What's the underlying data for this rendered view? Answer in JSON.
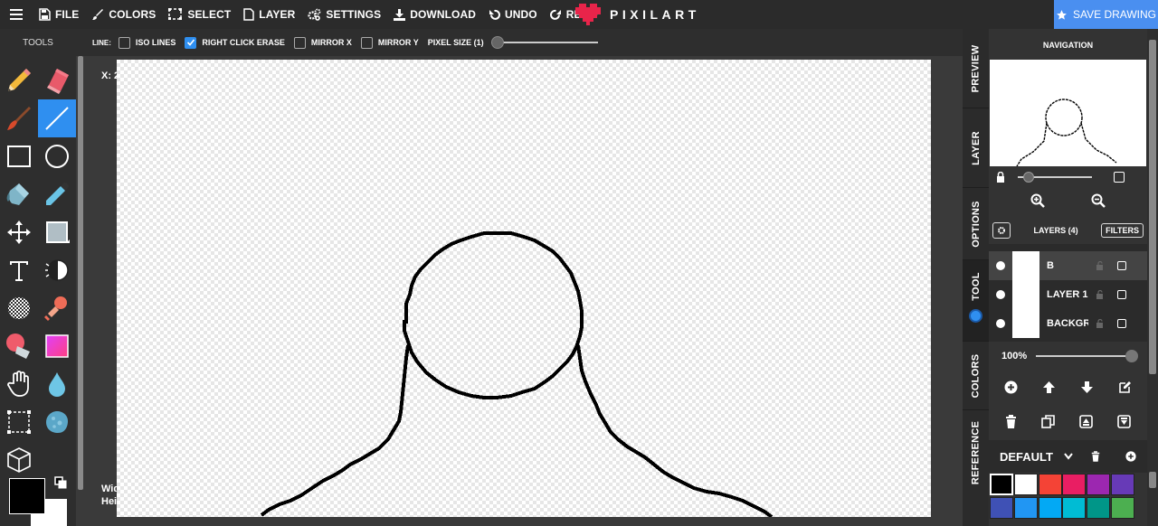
{
  "menu": {
    "items": [
      "FILE",
      "COLORS",
      "SELECT",
      "LAYER",
      "SETTINGS",
      "DOWNLOAD",
      "UNDO",
      "REDO"
    ],
    "logo": "PIXILART",
    "save": "SAVE DRAWING"
  },
  "tools": {
    "title": "TOOLS"
  },
  "options": {
    "line_label": "LINE:",
    "iso_lines": "ISO LINES",
    "right_click_erase": "RIGHT CLICK ERASE",
    "mirror_x": "MIRROR X",
    "mirror_y": "MIRROR Y",
    "pixel_size": "PIXEL SIZE (1)",
    "iso_checked": false,
    "erase_checked": true,
    "mirror_x_checked": false,
    "mirror_y_checked": false
  },
  "workspace": {
    "coord": "X: 2",
    "width_label": "Wid",
    "height_label": "Hei"
  },
  "sidetabs": [
    "PREVIEW",
    "LAYER",
    "OPTIONS",
    "TOOL",
    "COLORS",
    "REFERENCE"
  ],
  "navigation": {
    "title": "NAVIGATION"
  },
  "layers": {
    "title": "LAYERS (4)",
    "filters": "FILTERS",
    "items": [
      {
        "name": "B",
        "active": true
      },
      {
        "name": "LAYER 1",
        "active": false
      },
      {
        "name": "BACKGROUND",
        "active": false
      }
    ],
    "opacity": "100%"
  },
  "palette": {
    "name": "DEFAULT",
    "colors": [
      "#000000",
      "#ffffff",
      "#f44336",
      "#e91e63",
      "#9c27b0",
      "#673ab7",
      "#3f51b5",
      "#2196f3",
      "#03a9f4",
      "#00bcd4",
      "#009688",
      "#4caf50"
    ]
  }
}
